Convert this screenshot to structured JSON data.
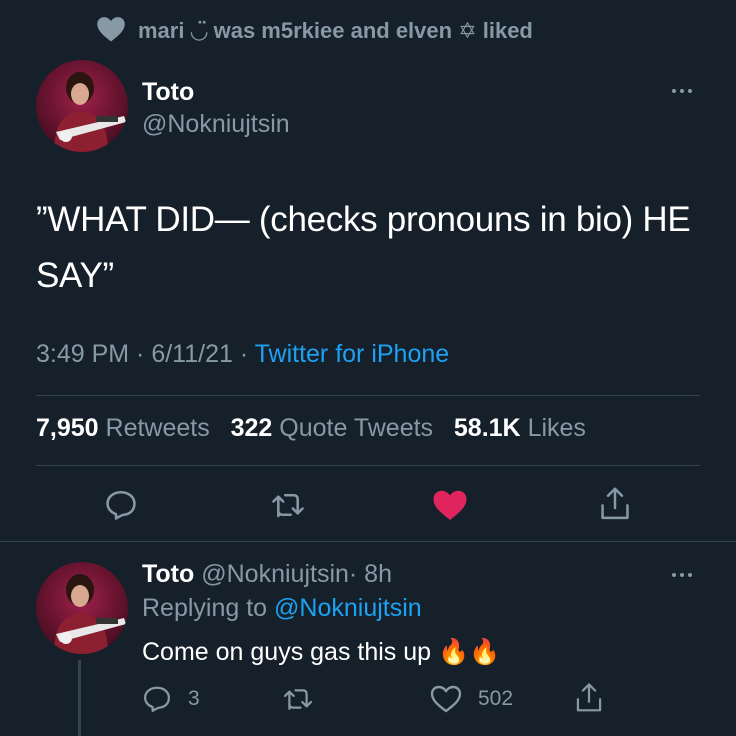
{
  "social_context": {
    "text": "mari ◡̈ was m5rkiee and elven ✡︎ liked",
    "icon": "heart-icon"
  },
  "tweet": {
    "author_name": "Toto",
    "author_handle": "@Nokniujtsin",
    "text": "”WHAT DID— (checks pronouns in bio) HE SAY”",
    "time": "3:49 PM · 6/11/21 · ",
    "source": "Twitter for iPhone",
    "stats": {
      "retweets_num": "7,950",
      "retweets_label": "Retweets",
      "quotes_num": "322",
      "quotes_label": "Quote Tweets",
      "likes_num": "58.1K",
      "likes_label": "Likes"
    },
    "actions": [
      "reply-icon",
      "retweet-icon",
      "like-icon",
      "share-icon"
    ],
    "liked": true
  },
  "reply": {
    "author_name": "Toto",
    "author_handle": "@Nokniujtsin",
    "time": "· 8h",
    "replying_prefix": "Replying to ",
    "replying_to": "@Nokniujtsin",
    "text": "Come on guys gas this up",
    "emoji": "🔥🔥",
    "reply_count": "3",
    "like_count": "502"
  },
  "colors": {
    "background": "#15202b",
    "secondary_text": "#8899a6",
    "link": "#1da1f2",
    "like": "#e0245e",
    "divider": "#38444d"
  }
}
